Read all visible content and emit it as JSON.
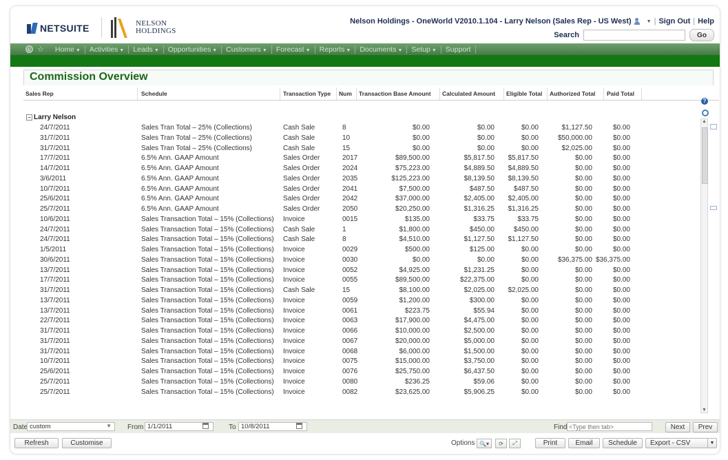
{
  "header": {
    "netsuite_text": "NETSUITE",
    "nelson_line1": "NELSON",
    "nelson_line2": "HOLDINGS",
    "account_info": "Nelson Holdings - OneWorld V2010.1.104 - Larry Nelson (Sales Rep - US West)",
    "sign_out": "Sign Out",
    "help": "Help",
    "search_label": "Search",
    "search_value": "",
    "go_label": "Go"
  },
  "nav": {
    "items": [
      "Home",
      "Activities",
      "Leads",
      "Opportunities",
      "Customers",
      "Forecast",
      "Reports",
      "Documents",
      "Setup",
      "Support"
    ]
  },
  "page": {
    "title": "Commission Overview"
  },
  "table": {
    "headers": [
      "Sales Rep",
      "Schedule",
      "Transaction Type",
      "Num",
      "Transaction Base Amount",
      "Calculated Amount",
      "Eligible Total",
      "Authorized Total",
      "Paid Total"
    ],
    "group": "Larry Nelson",
    "rows": [
      [
        "24/7/2011",
        "Sales Tran Total – 25% (Collections)",
        "Cash Sale",
        "8",
        "$0.00",
        "$0.00",
        "$0.00",
        "$1,127.50",
        "$0.00"
      ],
      [
        "31/7/2011",
        "Sales Tran Total – 25% (Collections)",
        "Cash Sale",
        "10",
        "$0.00",
        "$0.00",
        "$0.00",
        "$50,000.00",
        "$0.00"
      ],
      [
        "31/7/2011",
        "Sales Tran Total – 25% (Collections)",
        "Cash Sale",
        "15",
        "$0.00",
        "$0.00",
        "$0.00",
        "$2,025.00",
        "$0.00"
      ],
      [
        "17/7/2011",
        "6.5% Ann. GAAP Amount",
        "Sales Order",
        "2017",
        "$89,500.00",
        "$5,817.50",
        "$5,817.50",
        "$0.00",
        "$0.00"
      ],
      [
        "14/7/2011",
        "6.5% Ann. GAAP Amount",
        "Sales Order",
        "2024",
        "$75,223.00",
        "$4,889.50",
        "$4,889.50",
        "$0.00",
        "$0.00"
      ],
      [
        "3/6/2011",
        "6.5% Ann. GAAP Amount",
        "Sales Order",
        "2035",
        "$125,223.00",
        "$8,139.50",
        "$8,139.50",
        "$0.00",
        "$0.00"
      ],
      [
        "10/7/2011",
        "6.5% Ann. GAAP Amount",
        "Sales Order",
        "2041",
        "$7,500.00",
        "$487.50",
        "$487.50",
        "$0.00",
        "$0.00"
      ],
      [
        "25/6/2011",
        "6.5% Ann. GAAP Amount",
        "Sales Order",
        "2042",
        "$37,000.00",
        "$2,405.00",
        "$2,405.00",
        "$0.00",
        "$0.00"
      ],
      [
        "25/7/2011",
        "6.5% Ann. GAAP Amount",
        "Sales Order",
        "2050",
        "$20,250.00",
        "$1,316.25",
        "$1,316.25",
        "$0.00",
        "$0.00"
      ],
      [
        "10/6/2011",
        "Sales Transaction Total – 15% (Collections)",
        "Invoice",
        "0015",
        "$135.00",
        "$33.75",
        "$33.75",
        "$0.00",
        "$0.00"
      ],
      [
        "24/7/2011",
        "Sales Transaction Total – 15% (Collections)",
        "Cash Sale",
        "1",
        "$1,800.00",
        "$450.00",
        "$450.00",
        "$0.00",
        "$0.00"
      ],
      [
        "24/7/2011",
        "Sales Transaction Total – 15% (Collections)",
        "Cash Sale",
        "8",
        "$4,510.00",
        "$1,127.50",
        "$1,127.50",
        "$0.00",
        "$0.00"
      ],
      [
        "1/5/2011",
        "Sales Transaction Total – 15% (Collections)",
        "Invoice",
        "0029",
        "$500.00",
        "$125.00",
        "$0.00",
        "$0.00",
        "$0.00"
      ],
      [
        "30/6/2011",
        "Sales Transaction Total – 15% (Collections)",
        "Invoice",
        "0030",
        "$0.00",
        "$0.00",
        "$0.00",
        "$36,375.00",
        "$36,375.00"
      ],
      [
        "13/7/2011",
        "Sales Transaction Total – 15% (Collections)",
        "Invoice",
        "0052",
        "$4,925.00",
        "$1,231.25",
        "$0.00",
        "$0.00",
        "$0.00"
      ],
      [
        "17/7/2011",
        "Sales Transaction Total – 15% (Collections)",
        "Invoice",
        "0055",
        "$89,500.00",
        "$22,375.00",
        "$0.00",
        "$0.00",
        "$0.00"
      ],
      [
        "31/7/2011",
        "Sales Transaction Total – 15% (Collections)",
        "Cash Sale",
        "15",
        "$8,100.00",
        "$2,025.00",
        "$2,025.00",
        "$0.00",
        "$0.00"
      ],
      [
        "13/7/2011",
        "Sales Transaction Total – 15% (Collections)",
        "Invoice",
        "0059",
        "$1,200.00",
        "$300.00",
        "$0.00",
        "$0.00",
        "$0.00"
      ],
      [
        "13/7/2011",
        "Sales Transaction Total – 15% (Collections)",
        "Invoice",
        "0061",
        "$223.75",
        "$55.94",
        "$0.00",
        "$0.00",
        "$0.00"
      ],
      [
        "22/7/2011",
        "Sales Transaction Total – 15% (Collections)",
        "Invoice",
        "0063",
        "$17,900.00",
        "$4,475.00",
        "$0.00",
        "$0.00",
        "$0.00"
      ],
      [
        "31/7/2011",
        "Sales Transaction Total – 15% (Collections)",
        "Invoice",
        "0066",
        "$10,000.00",
        "$2,500.00",
        "$0.00",
        "$0.00",
        "$0.00"
      ],
      [
        "31/7/2011",
        "Sales Transaction Total – 15% (Collections)",
        "Invoice",
        "0067",
        "$20,000.00",
        "$5,000.00",
        "$0.00",
        "$0.00",
        "$0.00"
      ],
      [
        "31/7/2011",
        "Sales Transaction Total – 15% (Collections)",
        "Invoice",
        "0068",
        "$6,000.00",
        "$1,500.00",
        "$0.00",
        "$0.00",
        "$0.00"
      ],
      [
        "10/7/2011",
        "Sales Transaction Total – 15% (Collections)",
        "Invoice",
        "0075",
        "$15,000.00",
        "$3,750.00",
        "$0.00",
        "$0.00",
        "$0.00"
      ],
      [
        "25/6/2011",
        "Sales Transaction Total – 15% (Collections)",
        "Invoice",
        "0076",
        "$25,750.00",
        "$6,437.50",
        "$0.00",
        "$0.00",
        "$0.00"
      ],
      [
        "25/7/2011",
        "Sales Transaction Total – 15% (Collections)",
        "Invoice",
        "0080",
        "$236.25",
        "$59.06",
        "$0.00",
        "$0.00",
        "$0.00"
      ],
      [
        "25/7/2011",
        "Sales Transaction Total – 15% (Collections)",
        "Invoice",
        "0082",
        "$23,625.00",
        "$5,906.25",
        "$0.00",
        "$0.00",
        "$0.00"
      ]
    ]
  },
  "filters": {
    "date_label": "Date",
    "date_value": "custom",
    "from_label": "From",
    "from_value": "1/1/2011",
    "to_label": "To",
    "to_value": "10/8/2011",
    "find_label": "Find",
    "find_placeholder": "<Type then tab>",
    "next_label": "Next",
    "prev_label": "Prev"
  },
  "actions": {
    "refresh": "Refresh",
    "customise": "Customise",
    "options": "Options",
    "print": "Print",
    "email": "Email",
    "schedule": "Schedule",
    "export": "Export - CSV"
  }
}
